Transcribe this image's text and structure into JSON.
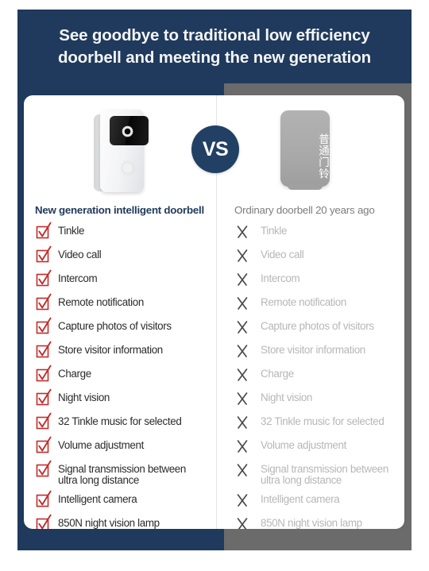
{
  "banner": {
    "title": "See goodbye to traditional low efficiency\ndoorbell and meeting the new generation"
  },
  "vs_badge": {
    "label": "VS"
  },
  "columns": {
    "left": {
      "heading": "New generation intelligent doorbell",
      "mark_icon": "red-checkbox-icon",
      "product_image_alt": "white smart video doorbell with camera lens and call button"
    },
    "right": {
      "heading": "Ordinary doorbell 20 years ago",
      "mark_icon": "gray-cross-icon",
      "product_image_alt": "gray ordinary doorbell box",
      "product_image_text": "普通门铃"
    }
  },
  "features": [
    {
      "label": "Tinkle",
      "new": true,
      "old": false
    },
    {
      "label": "Video call",
      "new": true,
      "old": false
    },
    {
      "label": "Intercom",
      "new": true,
      "old": false
    },
    {
      "label": "Remote notification",
      "new": true,
      "old": false
    },
    {
      "label": "Capture photos of visitors",
      "new": true,
      "old": false
    },
    {
      "label": "Store visitor information",
      "new": true,
      "old": false
    },
    {
      "label": "Charge",
      "new": true,
      "old": false
    },
    {
      "label": "Night vision",
      "new": true,
      "old": false
    },
    {
      "label": "32 Tinkle music for selected",
      "new": true,
      "old": false
    },
    {
      "label": "Volume adjustment",
      "new": true,
      "old": false
    },
    {
      "label": "Signal transmission between\nultra  long distance",
      "new": true,
      "old": false
    },
    {
      "label": "Intelligent camera",
      "new": true,
      "old": false
    },
    {
      "label": "850N night vision lamp",
      "new": true,
      "old": false
    }
  ],
  "colors": {
    "brand_navy": "#1f3a5c",
    "ordinary_gray": "#6b6b6b",
    "check_red": "#c42b2b",
    "cross_gray": "#4a4a4a",
    "disabled_text": "#b7b7b7",
    "card_white": "#ffffff"
  }
}
